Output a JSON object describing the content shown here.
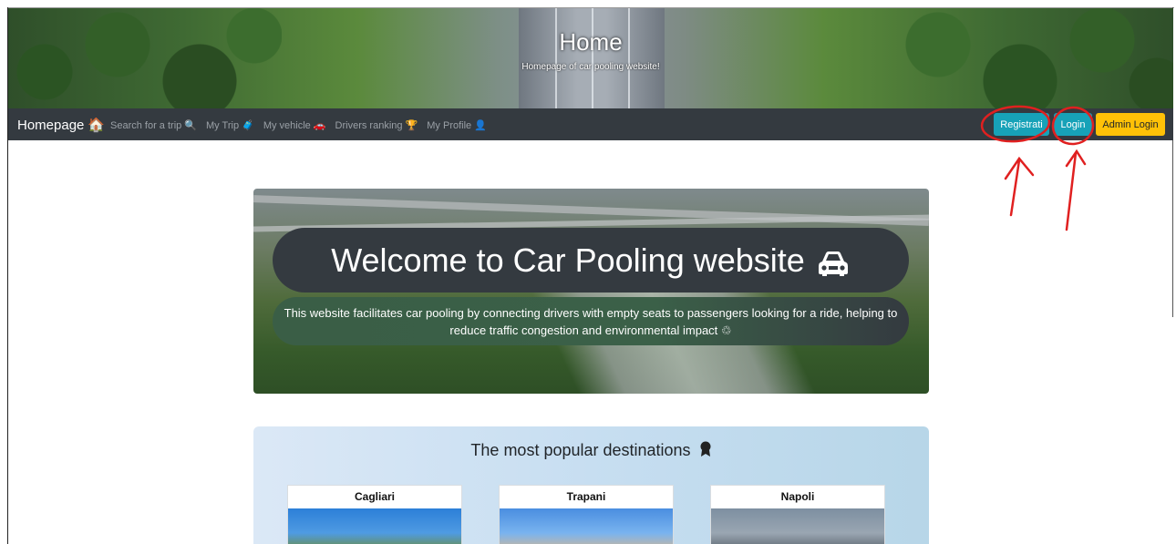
{
  "header": {
    "title": "Home",
    "subtitle": "Homepage of car pooling website!"
  },
  "navbar": {
    "brand": "Homepage",
    "brand_icon": "house-icon",
    "links": [
      {
        "label": "Search for a trip 🔍",
        "icon": "magnifier-icon"
      },
      {
        "label": "My Trip 🧳",
        "icon": "suitcase-icon"
      },
      {
        "label": "My vehicle 🚗",
        "icon": "car-icon"
      },
      {
        "label": "Drivers ranking 🏆",
        "icon": "trophy-icon"
      },
      {
        "label": "My Profile 👤",
        "icon": "person-icon"
      }
    ],
    "buttons": {
      "register": "Registrati",
      "login": "Login",
      "admin_login": "Admin Login"
    }
  },
  "hero": {
    "title": "Welcome to Car Pooling website",
    "title_icon": "car-icon",
    "description": "This website facilitates car pooling by connecting drivers with empty seats to passengers looking for a ride, helping to reduce traffic congestion and environmental impact ♲"
  },
  "destinations": {
    "title": "The most popular destinations",
    "title_icon": "medal-icon",
    "cards": [
      {
        "name": "Cagliari"
      },
      {
        "name": "Trapani"
      },
      {
        "name": "Napoli"
      }
    ]
  },
  "colors": {
    "navbar_bg": "#343a40",
    "info_button": "#17a2b8",
    "warning_button": "#ffc107",
    "annotation": "#e02020"
  }
}
